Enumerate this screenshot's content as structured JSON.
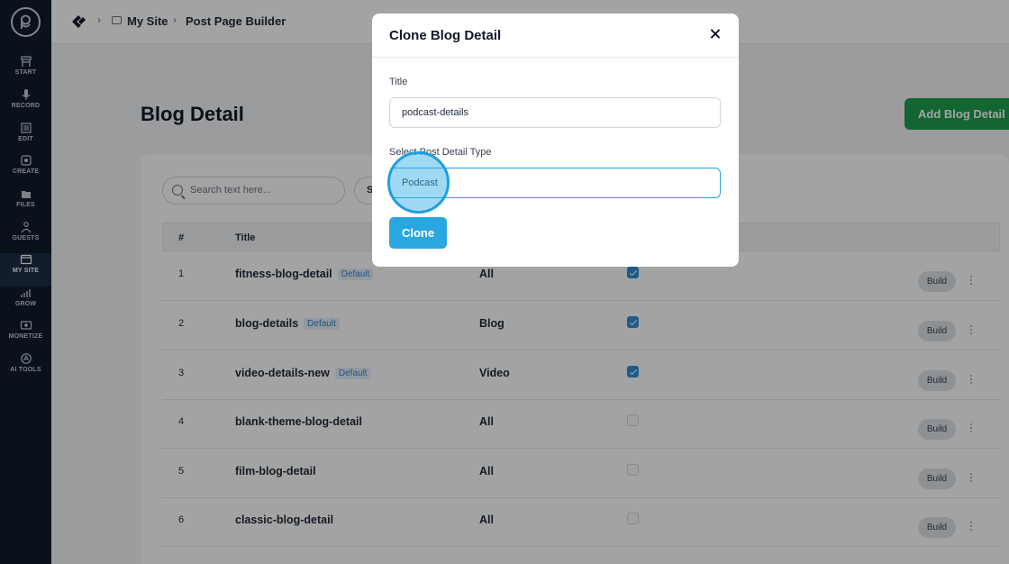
{
  "sidebar": {
    "items": [
      {
        "label": "START",
        "icon": "start-icon"
      },
      {
        "label": "RECORD",
        "icon": "mic-icon"
      },
      {
        "label": "EDIT",
        "icon": "edit-icon"
      },
      {
        "label": "CREATE",
        "icon": "create-icon"
      },
      {
        "label": "FILES",
        "icon": "files-icon"
      },
      {
        "label": "GUESTS",
        "icon": "guests-icon"
      },
      {
        "label": "MY SITE",
        "icon": "site-icon",
        "active": true
      },
      {
        "label": "GROW",
        "icon": "grow-icon"
      },
      {
        "label": "MONETIZE",
        "icon": "monetize-icon"
      },
      {
        "label": "AI TOOLS",
        "icon": "ai-tools-icon"
      }
    ]
  },
  "breadcrumb": {
    "site": "My Site",
    "page": "Post Page Builder"
  },
  "page": {
    "title": "Blog Detail",
    "add_button": "Add Blog Detail"
  },
  "search": {
    "placeholder": "Search text here...",
    "filter_partial": "S"
  },
  "table": {
    "columns": [
      "#",
      "Title"
    ],
    "rows": [
      {
        "num": "1",
        "title": "fitness-blog-detail",
        "badge": "Default",
        "type": "All",
        "checked": true,
        "action": "Build"
      },
      {
        "num": "2",
        "title": "blog-details",
        "badge": "Default",
        "type": "Blog",
        "checked": true,
        "action": "Build"
      },
      {
        "num": "3",
        "title": "video-details-new",
        "badge": "Default",
        "type": "Video",
        "checked": true,
        "action": "Build"
      },
      {
        "num": "4",
        "title": "blank-theme-blog-detail",
        "badge": "",
        "type": "All",
        "checked": false,
        "action": "Build"
      },
      {
        "num": "5",
        "title": "film-blog-detail",
        "badge": "",
        "type": "All",
        "checked": false,
        "action": "Build"
      },
      {
        "num": "6",
        "title": "classic-blog-detail",
        "badge": "",
        "type": "All",
        "checked": false,
        "action": "Build"
      }
    ]
  },
  "modal": {
    "title": "Clone Blog Detail",
    "title_label": "Title",
    "title_value": "podcast-details",
    "type_label": "Select Post Detail Type",
    "type_value": "Podcast",
    "clone_button": "Clone"
  },
  "colors": {
    "sidebar_bg": "#0f1b2b",
    "add_button": "#1e9e4f",
    "clone_button": "#2aa7e0",
    "checkbox": "#2f8fd9"
  }
}
